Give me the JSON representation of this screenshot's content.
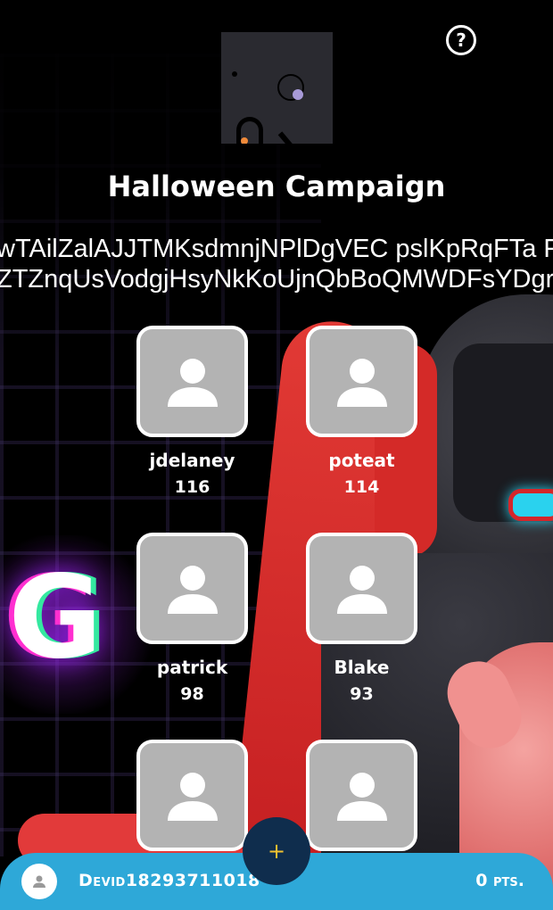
{
  "campaign": {
    "title": "Halloween Campaign",
    "description_lines": [
      "wTAilZalAJJTMKsdmnjNPlDgVEC pslKpRqFTa F",
      "ZTZnqUsVodgjHsyNkKoUjnQbBoQMWDFsYDgr"
    ]
  },
  "help_icon": "help-circle-icon",
  "players": [
    {
      "name": "jdelaney",
      "score": "116"
    },
    {
      "name": "poteat",
      "score": "114"
    },
    {
      "name": "patrick",
      "score": "98"
    },
    {
      "name": "Blake",
      "score": "93"
    },
    {
      "name": "",
      "score": ""
    },
    {
      "name": "",
      "score": ""
    }
  ],
  "footer": {
    "device_id": "Devid18293711018",
    "points": "0 pts."
  },
  "add_button": {
    "label": "+"
  },
  "colors": {
    "footer": "#2ea8d8",
    "add_button_bg": "#0f2d4d",
    "add_button_icon": "#f2c230",
    "avatar_placeholder": "#b3b3b3"
  }
}
